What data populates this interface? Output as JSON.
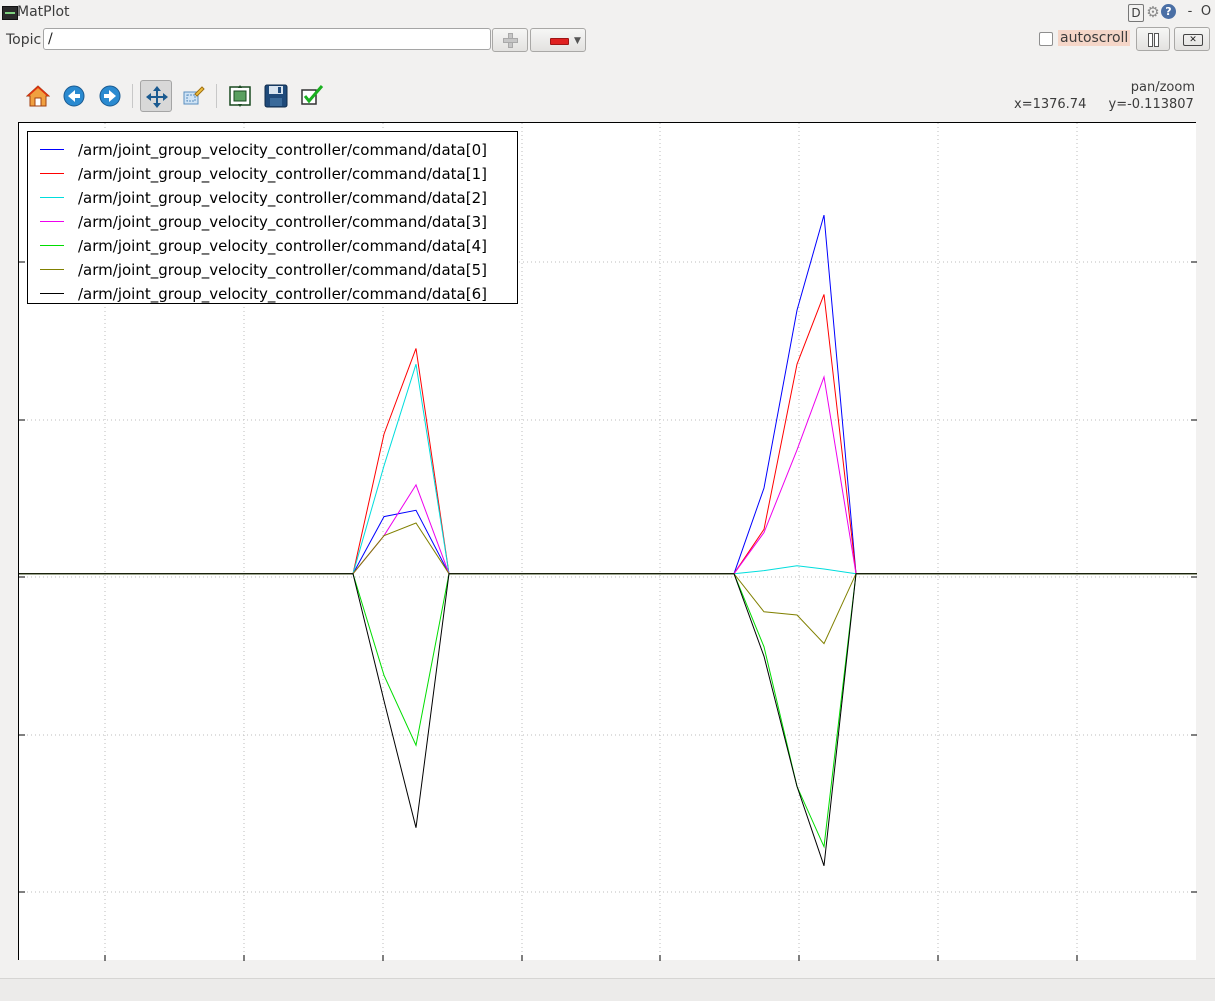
{
  "window": {
    "title": "MatPlot"
  },
  "title_controls": {
    "d_label": "D",
    "gear_label": "⚙",
    "help_label": "?",
    "min_label": "-",
    "close_label": "O"
  },
  "topic": {
    "label": "Topic",
    "value": "/"
  },
  "autoscroll": {
    "label": "autoscroll",
    "checked": false
  },
  "toolbar_icons": [
    "home-icon",
    "back-arrow-icon",
    "forward-arrow-icon",
    "pan-icon",
    "zoom-icon",
    "subplots-icon",
    "save-icon",
    "edit-check-icon"
  ],
  "status": {
    "mode": "pan/zoom",
    "x_readout": "x=1376.74",
    "y_readout": "y=-0.113807"
  },
  "chart_data": {
    "type": "line",
    "grid": true,
    "legend_position": "upper-left",
    "xlim": [
      0,
      1178
    ],
    "ylim": [
      -1.22,
      1.42
    ],
    "series": [
      {
        "name": "/arm/joint_group_velocity_controller/command/data[0]",
        "color": "#0000ff",
        "x": [
          0,
          334,
          365,
          397,
          430,
          715,
          745,
          778,
          805,
          837,
          1178
        ],
        "y": [
          0,
          0,
          0.18,
          0.2,
          0,
          0,
          0.27,
          0.83,
          1.13,
          0,
          0
        ]
      },
      {
        "name": "/arm/joint_group_velocity_controller/command/data[1]",
        "color": "#ff0000",
        "x": [
          0,
          334,
          365,
          397,
          430,
          715,
          745,
          778,
          805,
          837,
          1178
        ],
        "y": [
          0,
          0,
          0.44,
          0.71,
          0,
          0,
          0.14,
          0.66,
          0.88,
          0,
          0
        ]
      },
      {
        "name": "/arm/joint_group_velocity_controller/command/data[2]",
        "color": "#00dddd",
        "x": [
          0,
          334,
          365,
          397,
          430,
          715,
          745,
          778,
          805,
          837,
          1178
        ],
        "y": [
          0,
          0,
          0.34,
          0.66,
          0,
          0,
          0.01,
          0.025,
          0.015,
          0,
          0
        ]
      },
      {
        "name": "/arm/joint_group_velocity_controller/command/data[3]",
        "color": "#ee00ee",
        "x": [
          0,
          334,
          365,
          397,
          430,
          715,
          745,
          778,
          805,
          837,
          1178
        ],
        "y": [
          0,
          0,
          0.12,
          0.28,
          0,
          0,
          0.13,
          0.39,
          0.62,
          0,
          0
        ]
      },
      {
        "name": "/arm/joint_group_velocity_controller/command/data[4]",
        "color": "#00dd00",
        "x": [
          0,
          334,
          365,
          397,
          430,
          715,
          745,
          778,
          805,
          837,
          1178
        ],
        "y": [
          0,
          0,
          -0.32,
          -0.54,
          0,
          0,
          -0.23,
          -0.67,
          -0.86,
          0,
          0
        ]
      },
      {
        "name": "/arm/joint_group_velocity_controller/command/data[5]",
        "color": "#808000",
        "x": [
          0,
          334,
          365,
          397,
          430,
          715,
          745,
          778,
          805,
          837,
          1178
        ],
        "y": [
          0,
          0,
          0.12,
          0.16,
          0,
          0,
          -0.12,
          -0.13,
          -0.22,
          0,
          0
        ]
      },
      {
        "name": "/arm/joint_group_velocity_controller/command/data[6]",
        "color": "#000000",
        "x": [
          0,
          334,
          365,
          397,
          430,
          715,
          745,
          778,
          805,
          837,
          1178
        ],
        "y": [
          0,
          0,
          -0.4,
          -0.8,
          0,
          0,
          -0.26,
          -0.67,
          -0.92,
          0,
          0
        ]
      }
    ]
  }
}
